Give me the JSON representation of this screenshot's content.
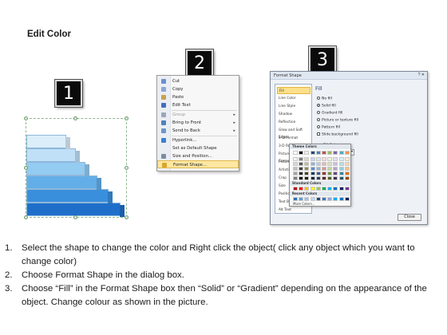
{
  "heading": "Edit Color",
  "badges": [
    "1",
    "2",
    "3"
  ],
  "context_menu": {
    "items": [
      {
        "label": "Cut",
        "icon": "scissors-icon",
        "color": "#6b8fd1"
      },
      {
        "label": "Copy",
        "icon": "copy-icon",
        "color": "#8aa6d9"
      },
      {
        "label": "Paste",
        "icon": "clipboard-icon",
        "color": "#c9a24a"
      },
      {
        "label": "Edit Text",
        "icon": "text-icon",
        "color": "#3f6fbf"
      },
      {
        "label": "Group",
        "icon": "group-icon",
        "color": "#9aa7b8",
        "disabled": true,
        "submenu": true
      },
      {
        "label": "Bring to Front",
        "icon": "bring-front-icon",
        "color": "#4f81bd",
        "submenu": true
      },
      {
        "label": "Send to Back",
        "icon": "send-back-icon",
        "color": "#6e95c8",
        "submenu": true
      },
      {
        "label": "Hyperlink...",
        "icon": "globe-icon",
        "color": "#3a7fd5"
      },
      {
        "label": "Set as Default Shape",
        "icon": "",
        "color": ""
      },
      {
        "label": "Size and Position...",
        "icon": "size-icon",
        "color": "#7c8da3"
      },
      {
        "label": "Format Shape...",
        "icon": "format-icon",
        "color": "#d9a52f",
        "highlighted": true
      }
    ]
  },
  "dialog": {
    "title": "Format Shape",
    "close_label": "Close",
    "categories": [
      "Fill",
      "Line Color",
      "Line Style",
      "Shadow",
      "Reflection",
      "Glow and Soft Edges",
      "3-D Format",
      "3-D Rotation",
      "Picture Corrections",
      "Picture Color",
      "Artistic Effects",
      "Crop",
      "Size",
      "Position",
      "Text Box",
      "Alt Text"
    ],
    "selected_category": "Fill",
    "pane_title": "Fill",
    "fill_options": [
      {
        "label": "No fill",
        "selected": false
      },
      {
        "label": "Solid fill",
        "selected": true
      },
      {
        "label": "Gradient fill",
        "selected": false
      },
      {
        "label": "Picture or texture fill",
        "selected": false
      },
      {
        "label": "Pattern fill",
        "selected": false
      },
      {
        "label": "Slide background fill",
        "selected": false
      }
    ],
    "fill_color_label": "Fill Color",
    "color_label": "Color:",
    "transparency_label": "Transpar",
    "palette": {
      "theme_header": "Theme Colors",
      "standard_header": "Standard Colors",
      "recent_header": "Recent Colors",
      "more_label": "More Colors...",
      "theme_top": [
        "#ffffff",
        "#000000",
        "#eeece1",
        "#1f497d",
        "#4f81bd",
        "#c0504d",
        "#9bbb59",
        "#8064a2",
        "#4bacc6",
        "#f79646"
      ],
      "theme_shades": [
        [
          "#f2f2f2",
          "#7f7f7f",
          "#ddd9c3",
          "#c6d9f0",
          "#dbe5f1",
          "#f2dcdb",
          "#ebf1dd",
          "#e5e0ec",
          "#dbeef3",
          "#fdeada"
        ],
        [
          "#d8d8d8",
          "#595959",
          "#c4bd97",
          "#8db3e2",
          "#b8cce4",
          "#e5b9b7",
          "#d7e3bc",
          "#ccc1d9",
          "#b7dde8",
          "#fbd5b5"
        ],
        [
          "#bfbfbf",
          "#3f3f3f",
          "#938953",
          "#548dd4",
          "#95b3d7",
          "#d99694",
          "#c3d69b",
          "#b2a2c7",
          "#92cddc",
          "#fac08f"
        ],
        [
          "#a5a5a5",
          "#262626",
          "#494429",
          "#17365d",
          "#366092",
          "#953734",
          "#76923c",
          "#5f497a",
          "#31859b",
          "#e36c09"
        ],
        [
          "#7f7f7f",
          "#0c0c0c",
          "#1d1b10",
          "#0f243e",
          "#244061",
          "#632423",
          "#4f6128",
          "#3f3151",
          "#205867",
          "#974806"
        ]
      ],
      "standard": [
        "#c00000",
        "#ff0000",
        "#ffc000",
        "#ffff00",
        "#92d050",
        "#00b050",
        "#00b0f0",
        "#0070c0",
        "#002060",
        "#7030a0"
      ],
      "recent": [
        "#2e75b6",
        "#5b9bd5",
        "#9dc3e6",
        "#bdd7ee",
        "#1f4e79",
        "#4472c4",
        "#8faadc",
        "#00b0f0",
        "#0070c0",
        "#002060"
      ]
    }
  },
  "stairs": {
    "steps": [
      {
        "width_fraction": 0.42,
        "color": "#dbeefa"
      },
      {
        "width_fraction": 0.52,
        "color": "#bfe0f7"
      },
      {
        "width_fraction": 0.62,
        "color": "#94cbf1"
      },
      {
        "width_fraction": 0.74,
        "color": "#63aee8"
      },
      {
        "width_fraction": 0.86,
        "color": "#3a8fdc"
      },
      {
        "width_fraction": 0.98,
        "color": "#1f6fca"
      }
    ]
  },
  "instructions": [
    {
      "num": "1.",
      "text": "Select the shape to change the color and Right click the object( click any object which you want to change color)"
    },
    {
      "num": "2.",
      "text": "Choose Format Shape in the dialog box."
    },
    {
      "num": "3.",
      "text": "Choose “Fill” in the Format Shape box then “Solid” or “Gradient” depending on the appearance of the object. Change colour as shown in the picture."
    }
  ]
}
